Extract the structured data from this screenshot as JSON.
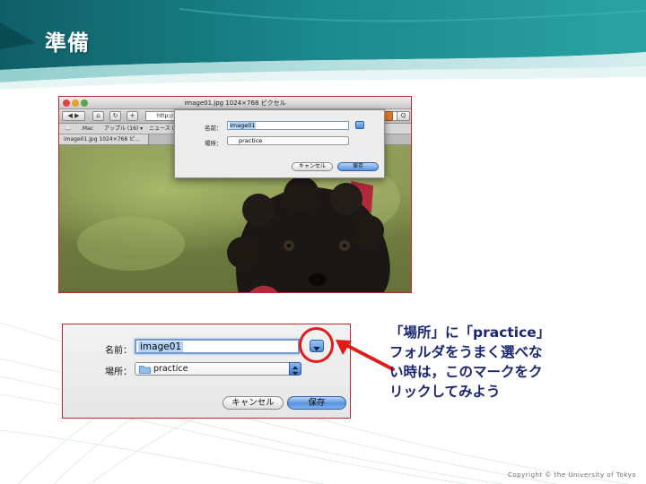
{
  "slide": {
    "title": "準備",
    "copyright": "Copyright © the University of Tokyo"
  },
  "browser": {
    "window_title": "image01.jpg 1024×768 ピクセル",
    "url_prefix": "http://",
    "bookmarks": [
      ".Mac",
      "アップル (16) ▾",
      "ニュース ("
    ],
    "tab_label": "image01.jpg 1024×768 ピ..."
  },
  "save_dialog": {
    "name_label": "名前：",
    "name_value": "image01",
    "location_label": "場所：",
    "location_value": "practice",
    "cancel_label": "キャンセル",
    "save_label": "保存"
  },
  "instruction": {
    "lines": [
      "「場所」に「practice」",
      "フォルダをうまく選べな",
      "い時は，このマークをク",
      "リックしてみよう"
    ]
  },
  "colors": {
    "highlight": "#e11a1a",
    "instruction_text": "#1a2670",
    "header_teal": "#1c8a8f"
  }
}
